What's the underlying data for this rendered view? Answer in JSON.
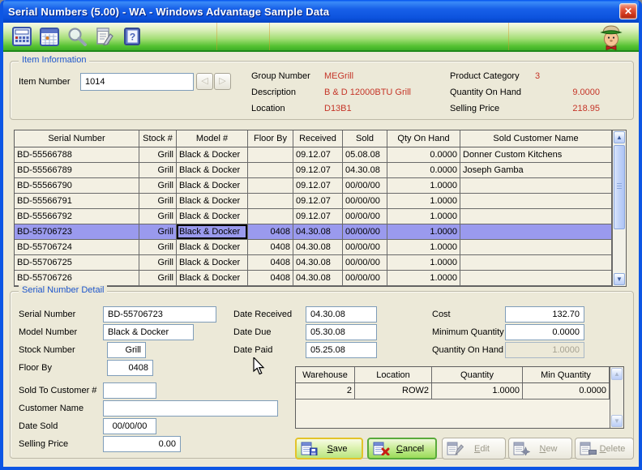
{
  "window": {
    "title": "Serial Numbers (5.00) - WA - Windows Advantage Sample Data"
  },
  "toolbar": {
    "icons": [
      "calculator",
      "calendar",
      "search",
      "notes",
      "help"
    ],
    "mascot": "assistant-character"
  },
  "item_information": {
    "section_title": "Item Information",
    "item_number_label": "Item Number",
    "item_number_value": "1014",
    "group_number_label": "Group Number",
    "group_number_value": "MEGrill",
    "description_label": "Description",
    "description_value": "B & D 12000BTU Grill",
    "location_label": "Location",
    "location_value": "D13B1",
    "product_category_label": "Product Category",
    "product_category_value": "3",
    "quantity_on_hand_label": "Quantity On Hand",
    "quantity_on_hand_value": "9.0000",
    "selling_price_label": "Selling Price",
    "selling_price_value": "218.95"
  },
  "serial_table": {
    "columns": [
      "Serial Number",
      "Stock #",
      "Model #",
      "Floor By",
      "Received",
      "Sold",
      "Qty On Hand",
      "Sold Customer Name"
    ],
    "rows": [
      [
        "BD-55566788",
        "Grill",
        "Black & Docker",
        "",
        "09.12.07",
        "05.08.08",
        "0.0000",
        "Donner Custom Kitchens"
      ],
      [
        "BD-55566789",
        "Grill",
        "Black & Docker",
        "",
        "09.12.07",
        "04.30.08",
        "0.0000",
        "Joseph Gamba"
      ],
      [
        "BD-55566790",
        "Grill",
        "Black & Docker",
        "",
        "09.12.07",
        "00/00/00",
        "1.0000",
        ""
      ],
      [
        "BD-55566791",
        "Grill",
        "Black & Docker",
        "",
        "09.12.07",
        "00/00/00",
        "1.0000",
        ""
      ],
      [
        "BD-55566792",
        "Grill",
        "Black & Docker",
        "",
        "09.12.07",
        "00/00/00",
        "1.0000",
        ""
      ],
      [
        "BD-55706723",
        "Grill",
        "Black & Docker",
        "0408",
        "04.30.08",
        "00/00/00",
        "1.0000",
        ""
      ],
      [
        "BD-55706724",
        "Grill",
        "Black & Docker",
        "0408",
        "04.30.08",
        "00/00/00",
        "1.0000",
        ""
      ],
      [
        "BD-55706725",
        "Grill",
        "Black & Docker",
        "0408",
        "04.30.08",
        "00/00/00",
        "1.0000",
        ""
      ],
      [
        "BD-55706726",
        "Grill",
        "Black & Docker",
        "0408",
        "04.30.08",
        "00/00/00",
        "1.0000",
        ""
      ]
    ],
    "selected_row_index": 5,
    "focused_column_index": 2,
    "selected_row_color": "#9A9AEE"
  },
  "serial_detail": {
    "section_title": "Serial Number Detail",
    "serial_number_label": "Serial Number",
    "serial_number_value": "BD-55706723",
    "model_number_label": "Model Number",
    "model_number_value": "Black & Docker",
    "stock_number_label": "Stock Number",
    "stock_number_value": "Grill",
    "floor_by_label": "Floor By",
    "floor_by_value": "0408",
    "sold_to_customer_label": "Sold To Customer #",
    "sold_to_customer_value": "",
    "customer_name_label": "Customer Name",
    "customer_name_value": "",
    "date_sold_label": "Date Sold",
    "date_sold_value": "00/00/00",
    "selling_price_label": "Selling Price",
    "selling_price_value": "0.00",
    "date_received_label": "Date Received",
    "date_received_value": "04.30.08",
    "date_due_label": "Date Due",
    "date_due_value": "05.30.08",
    "date_paid_label": "Date Paid",
    "date_paid_value": "05.25.08",
    "cost_label": "Cost",
    "cost_value": "132.70",
    "minimum_quantity_label": "Minimum Quantity",
    "minimum_quantity_value": "0.0000",
    "quantity_on_hand_label": "Quantity On Hand",
    "quantity_on_hand_value": "1.0000"
  },
  "warehouse_table": {
    "columns": [
      "Warehouse",
      "Location",
      "Quantity",
      "Min Quantity"
    ],
    "rows": [
      [
        "2",
        "ROW2",
        "1.0000",
        "0.0000"
      ]
    ]
  },
  "action_buttons": {
    "save": "Save",
    "cancel": "Cancel",
    "edit": "Edit",
    "new": "New",
    "delete": "Delete"
  },
  "colors": {
    "title_blue": "#0D53DE",
    "toolbar_green": "#42B62B",
    "selected_row": "#9A9AEE",
    "value_red": "#C53528"
  }
}
